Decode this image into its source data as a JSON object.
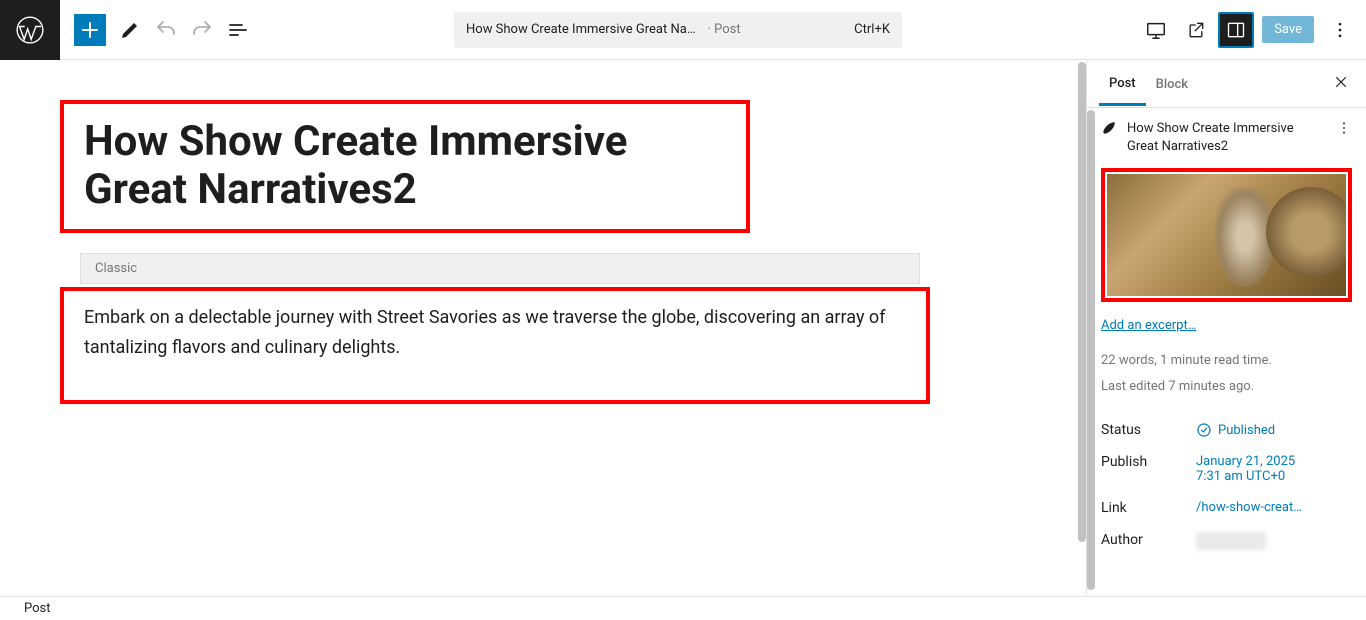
{
  "topbar": {
    "doc_title": "How Show Create Immersive Great Na…",
    "doc_type": "· Post",
    "shortcut": "Ctrl+K",
    "save": "Save"
  },
  "editor": {
    "title": "How Show Create Immersive Great Narratives2",
    "classic_label": "Classic",
    "content": "Embark on a delectable journey with Street Savories as we traverse the globe, discovering an array of tantalizing flavors and culinary delights."
  },
  "sidebar": {
    "tabs": {
      "post": "Post",
      "block": "Block"
    },
    "post_title": "How Show Create Immersive Great Narratives2",
    "excerpt_link": "Add an excerpt…",
    "word_stats": "22 words, 1 minute read time.",
    "last_edited": "Last edited 7 minutes ago.",
    "rows": {
      "status_label": "Status",
      "status_value": "Published",
      "publish_label": "Publish",
      "publish_value_line1": "January 21, 2025",
      "publish_value_line2": "7:31 am UTC+0",
      "link_label": "Link",
      "link_value": "/how-show-creat…",
      "author_label": "Author"
    }
  },
  "footer": {
    "breadcrumb": "Post"
  }
}
